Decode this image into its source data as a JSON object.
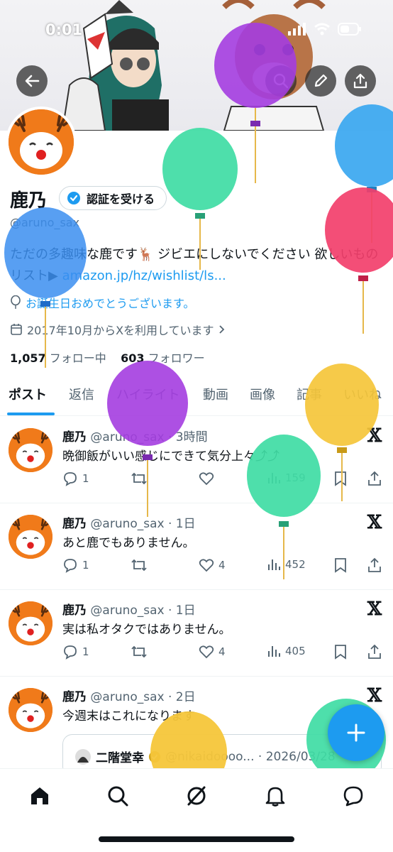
{
  "status_bar": {
    "time": "0:01"
  },
  "profile": {
    "display_name": "鹿乃",
    "verify_button_label": "認証を受ける",
    "handle": "@aruno_sax",
    "bio_text": "ただの多趣味な鹿です🦌 ジビエにしないでください 欲しいものリスト▶ ",
    "bio_link": "amazon.jp/hz/wishlist/ls...",
    "birthday_text": "お誕生日おめでとうございます。",
    "joined_text": "2017年10月からXを利用しています",
    "following_count": "1,057",
    "following_label": "フォロー中",
    "followers_count": "603",
    "followers_label": "フォロワー"
  },
  "tabs": [
    {
      "label": "ポスト",
      "active": true
    },
    {
      "label": "返信"
    },
    {
      "label": "ハイライト"
    },
    {
      "label": "動画"
    },
    {
      "label": "画像"
    },
    {
      "label": "記事"
    },
    {
      "label": "いいね"
    }
  ],
  "posts": [
    {
      "name": "鹿乃",
      "meta": "@aruno_sax · 3時間",
      "text": "晩御飯がいい感じにできて気分上々⤴︎⤴︎",
      "replies": "1",
      "likes": "",
      "views": "159"
    },
    {
      "name": "鹿乃",
      "meta": "@aruno_sax · 1日",
      "text": "あと鹿でもありません。",
      "replies": "1",
      "likes": "4",
      "views": "452"
    },
    {
      "name": "鹿乃",
      "meta": "@aruno_sax · 1日",
      "text": "実は私オタクではありません。",
      "replies": "1",
      "likes": "4",
      "views": "405"
    },
    {
      "name": "鹿乃",
      "meta": "@aruno_sax · 2日",
      "text": "今週末はこれになります"
    }
  ],
  "quote": {
    "name": "二階堂幸",
    "meta": "@nikaidoooo... · 2026/03/28"
  },
  "colors": {
    "accent": "#1d9bf0",
    "avatar_bg": "#f07a1a"
  },
  "icons": {
    "back": "arrow-left-icon",
    "search_header": "search-icon",
    "edit": "pencil-icon",
    "share": "share-icon",
    "nav": [
      "home-icon",
      "search-icon",
      "grok-icon",
      "bell-icon",
      "message-icon"
    ]
  }
}
